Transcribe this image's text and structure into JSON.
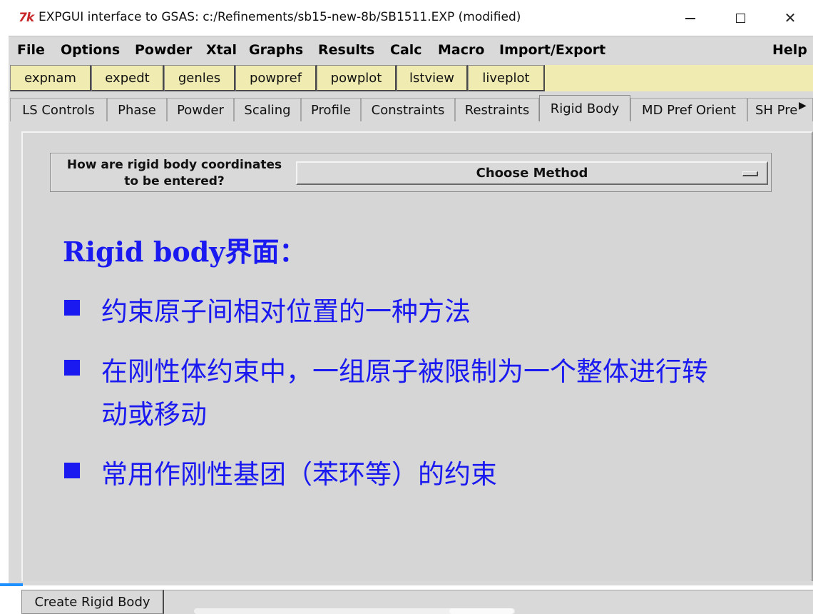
{
  "window": {
    "logo_text": "7k",
    "title": "EXPGUI interface to GSAS: c:/Refinements/sb15-new-8b/SB1511.EXP (modified)",
    "controls": {
      "minimize": "minimize-icon",
      "maximize": "maximize-icon",
      "close": "close-icon"
    }
  },
  "menubar": {
    "items": [
      "File",
      "Options",
      "Powder",
      "Xtal",
      "Graphs",
      "Results",
      "Calc",
      "Macro",
      "Import/Export"
    ],
    "help": "Help"
  },
  "toolbar": {
    "buttons": [
      "expnam",
      "expedt",
      "genles",
      "powpref",
      "powplot",
      "lstview",
      "liveplot"
    ],
    "button_color": "#f0ebb0"
  },
  "tabs": {
    "items": [
      "LS Controls",
      "Phase",
      "Powder",
      "Scaling",
      "Profile",
      "Constraints",
      "Restraints",
      "Rigid Body",
      "MD Pref Orient",
      "SH Pre"
    ],
    "active": "Rigid Body",
    "more_icon": "chevron-right-icon"
  },
  "rigid_body": {
    "question_line1": "How are rigid body coordinates",
    "question_line2": "to be entered?",
    "method_select": "Choose Method"
  },
  "overlay": {
    "color": "#1a1af0",
    "heading": "Rigid body界面：",
    "bullets": [
      "约束原子间相对位置的一种方法",
      "在刚性体约束中，一组原子被限制为一个整体进行转",
      "动或移动",
      "常用作刚性基团（苯环等）的约束"
    ]
  },
  "bottom": {
    "create_button": "Create Rigid Body"
  }
}
